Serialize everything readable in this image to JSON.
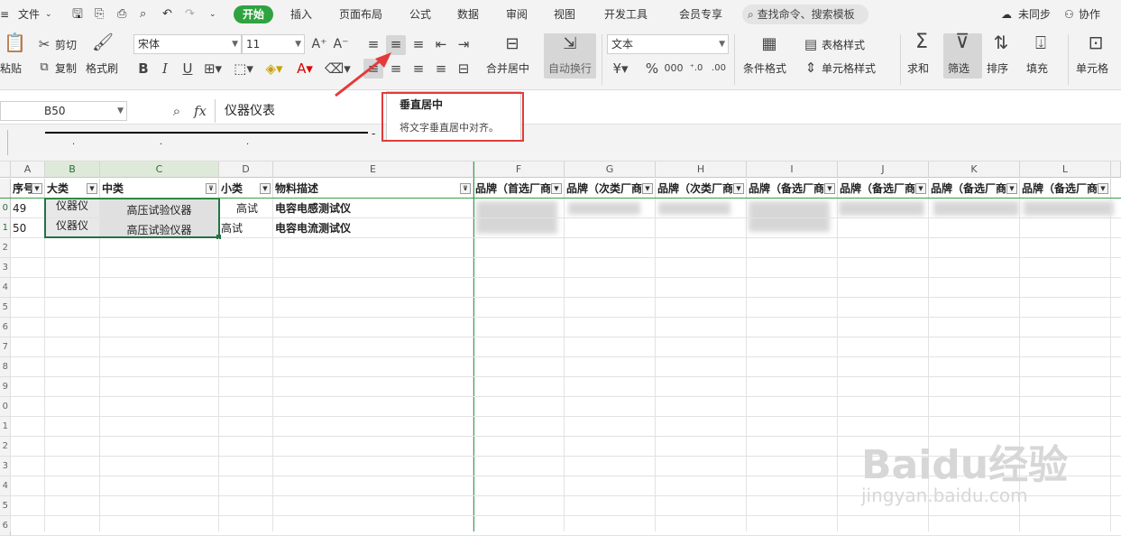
{
  "menubar": {
    "file": "文件",
    "tabs": [
      "开始",
      "插入",
      "页面布局",
      "公式",
      "数据",
      "审阅",
      "视图",
      "开发工具",
      "会员专享"
    ],
    "search": "查找命令、搜索模板",
    "sync": "未同步",
    "collab": "协作"
  },
  "ribbon": {
    "cut": "剪切",
    "copy": "复制",
    "paste": "粘贴",
    "format_painter": "格式刷",
    "font_name": "宋体",
    "font_size": "11",
    "bold": "B",
    "italic": "I",
    "underline": "U",
    "merge_center": "合并居中",
    "wrap_text": "自动换行",
    "number_format": "文本",
    "conditional_format": "条件格式",
    "table_style": "表格样式",
    "cell_style": "单元格样式",
    "sum": "求和",
    "filter": "筛选",
    "sort": "排序",
    "fill": "填充",
    "cells": "单元格"
  },
  "tooltip": {
    "title": "垂直居中",
    "desc": "将文字垂直居中对齐。"
  },
  "formula_bar": {
    "name_box": "B50",
    "fx": "fx",
    "content": "仪器仪表"
  },
  "columns": [
    "A",
    "B",
    "C",
    "D",
    "E",
    "F",
    "G",
    "H",
    "I",
    "J",
    "K",
    "L"
  ],
  "header_row": {
    "row_num": "",
    "cells": [
      "序号",
      "大类",
      "中类",
      "小类",
      "物料描述",
      "品牌（首选厂商",
      "品牌（次类厂商",
      "品牌（次类厂商",
      "品牌（备选厂商",
      "品牌（备选厂商",
      "品牌（备选厂商",
      "品牌（备选厂商"
    ]
  },
  "rows": [
    {
      "row_num": "0",
      "seq": "49",
      "major": "仪器仪",
      "mid": "高压试验仪器",
      "minor": "高试",
      "desc": "电容电感测试仪"
    },
    {
      "row_num": "1",
      "seq": "50",
      "major": "仪器仪",
      "mid": "高压试验仪器",
      "minor": "高试",
      "desc": "电容电流测试仪"
    }
  ],
  "empty_rows": [
    "2",
    "3",
    "4",
    "5",
    "6",
    "7",
    "8",
    "9",
    "0",
    "1",
    "2",
    "3",
    "4",
    "5",
    "6"
  ],
  "watermark": {
    "brand": "Baidu经验",
    "url": "jingyan.baidu.com"
  },
  "colors": {
    "accent": "#2fa340",
    "selection": "#217346",
    "tooltip_border": "#e43a3a"
  }
}
